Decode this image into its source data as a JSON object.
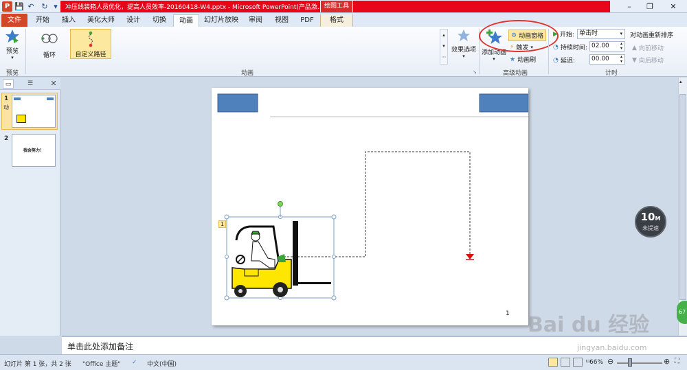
{
  "window": {
    "title": "冲压线装箱人员优化，提高人员效率-20160418-W4.pptx - Microsoft PowerPoint(产品激...",
    "context_tab": "绘图工具",
    "controls": [
      "–",
      "❐",
      "✕"
    ]
  },
  "quick_access": [
    "💾",
    "↶",
    "↻",
    "▾"
  ],
  "tabs": {
    "file": "文件",
    "items": [
      "开始",
      "插入",
      "美化大师",
      "设计",
      "切换",
      "动画",
      "幻灯片放映",
      "审阅",
      "视图",
      "PDF",
      "格式"
    ],
    "active": "动画"
  },
  "ribbon": {
    "preview": {
      "label": "预览",
      "group": "预览"
    },
    "animation_gallery": {
      "items": [
        "循环",
        "自定义路径"
      ],
      "group": "动画",
      "effect_options": "效果选项"
    },
    "advanced": {
      "add_animation": "添加动画",
      "animation_pane": "动画窗格",
      "trigger": "触发",
      "animation_painter": "动画刷",
      "group": "高级动画"
    },
    "timing": {
      "start_label": "开始:",
      "start_value": "单击时",
      "duration_label": "持续时间:",
      "duration_value": "02.00",
      "delay_label": "延迟:",
      "delay_value": "00.00",
      "reorder_title": "对动画重新排序",
      "move_earlier": "向前移动",
      "move_later": "向后移动",
      "group": "计时"
    }
  },
  "slides_panel": {
    "slides": [
      {
        "num": "1",
        "marker": "动"
      },
      {
        "num": "2",
        "text": "我会努力！"
      }
    ]
  },
  "slide": {
    "page_number": "1",
    "anim_tag": "1"
  },
  "notes": {
    "placeholder": "单击此处添加备注"
  },
  "status": {
    "slide_info": "幻灯片 第 1 张，共 2 张",
    "theme": "\"Office 主题\"",
    "language": "中文(中国)",
    "zoom": "66%"
  },
  "overlay": {
    "timer_value": "10",
    "timer_unit": "M",
    "timer_sub": "未提速",
    "badge": "67",
    "watermark": "Bai du 经验",
    "watermark_url": "jingyan.baidu.com"
  }
}
